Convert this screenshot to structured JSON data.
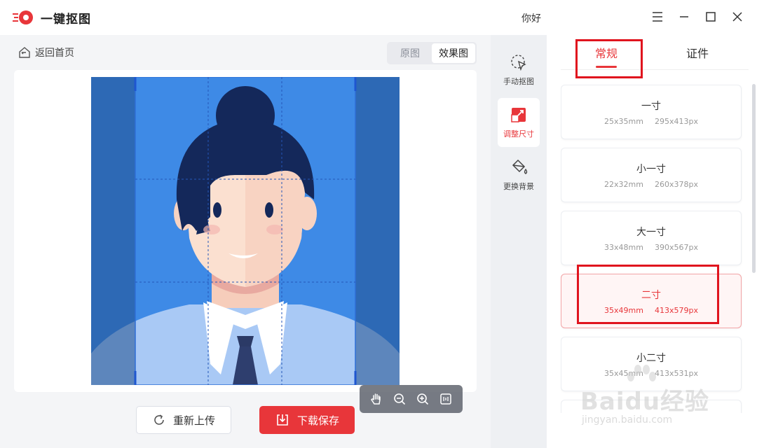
{
  "titlebar": {
    "app_name": "一键抠图",
    "greeting": "你好"
  },
  "main": {
    "back_label": "返回首页",
    "toggle": {
      "original": "原图",
      "result": "效果图"
    },
    "reupload_label": "重新上传",
    "save_label": "下载保存"
  },
  "tools": [
    {
      "label": "手动抠图",
      "icon": "cursor-select-icon"
    },
    {
      "label": "调整尺寸",
      "icon": "resize-icon",
      "active": true
    },
    {
      "label": "更换背景",
      "icon": "paint-bucket-icon"
    }
  ],
  "sizes": {
    "tabs": [
      {
        "label": "常规",
        "active": true
      },
      {
        "label": "证件"
      }
    ],
    "items": [
      {
        "name": "一寸",
        "mm": "25x35mm",
        "px": "295x413px"
      },
      {
        "name": "小一寸",
        "mm": "22x32mm",
        "px": "260x378px"
      },
      {
        "name": "大一寸",
        "mm": "33x48mm",
        "px": "390x567px"
      },
      {
        "name": "二寸",
        "mm": "35x49mm",
        "px": "413x579px",
        "selected": true
      },
      {
        "name": "小二寸",
        "mm": "35x45mm",
        "px": "413x531px"
      }
    ]
  },
  "watermark": {
    "main": "Baidu经验",
    "sub": "jingyan.baidu.com"
  },
  "colors": {
    "accent": "#e8363a",
    "photo_bg": "#3e8ae6",
    "outside_crop": "#2b65a8"
  }
}
